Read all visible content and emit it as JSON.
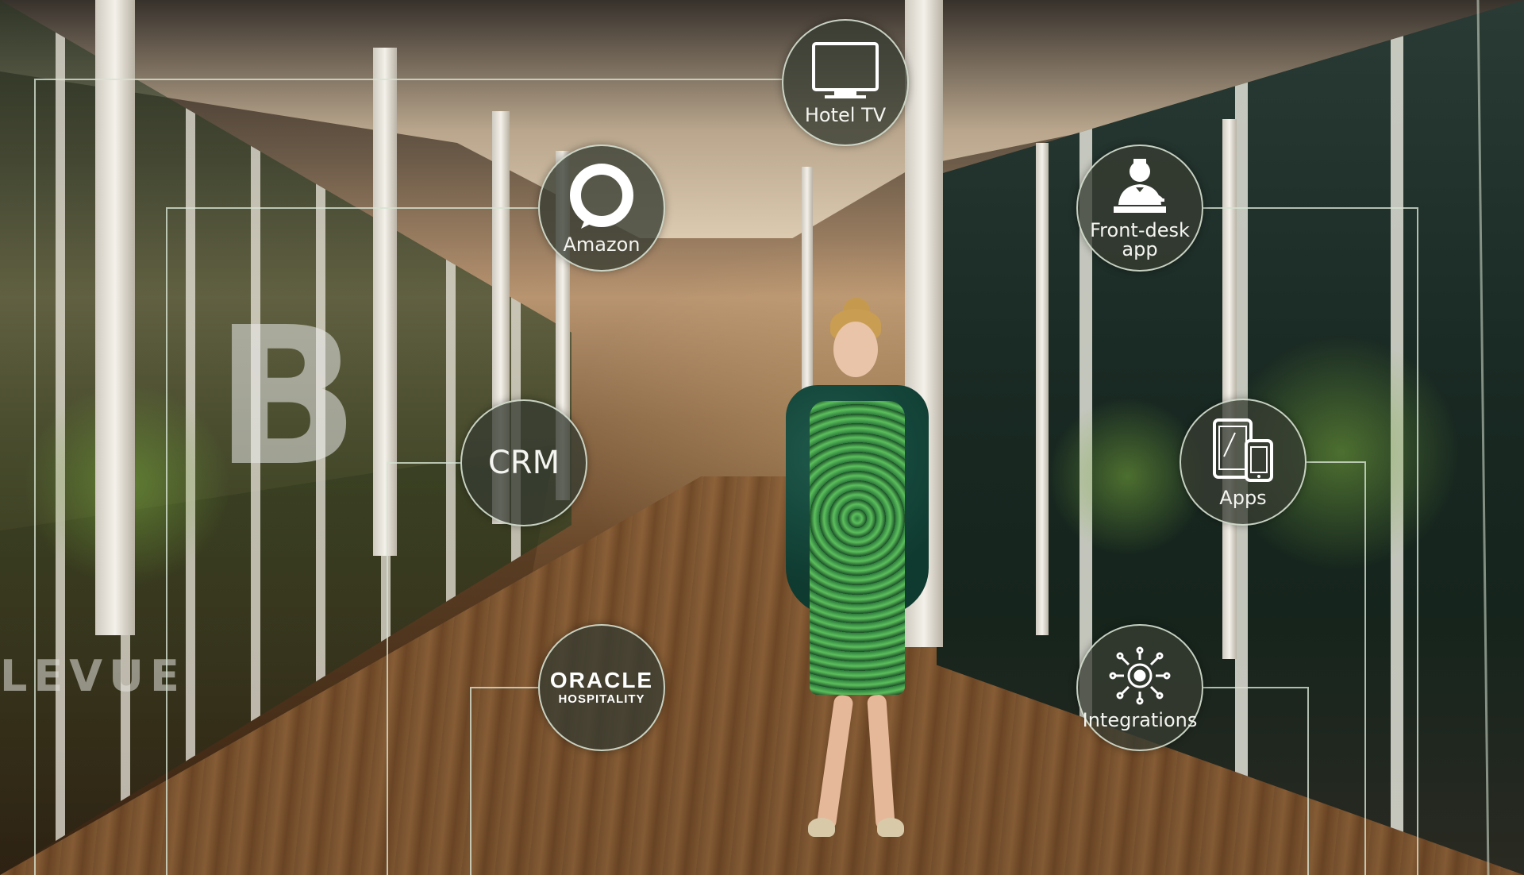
{
  "hubs": {
    "hotel_tv": {
      "label": "Hotel TV",
      "icon": "tv-icon"
    },
    "amazon": {
      "label": "Amazon",
      "icon": "amazon-alexa-ring-icon"
    },
    "front_desk": {
      "label_line1": "Front-desk",
      "label_line2": "app",
      "icon": "concierge-person-icon"
    },
    "crm": {
      "label": "CRM"
    },
    "apps": {
      "label": "Apps",
      "icon": "tablet-phone-icon"
    },
    "oracle": {
      "brand": "ORACLE",
      "sub": "HOSPITALITY"
    },
    "integrations": {
      "label": "Integrations",
      "icon": "gear-circuit-icon"
    }
  },
  "background": {
    "logo_letter": "B",
    "logo_word": "LEVUE"
  },
  "colors": {
    "hub_fill": "#373c32",
    "hub_border": "#e1ebdc",
    "line": "#d6e3d2"
  }
}
